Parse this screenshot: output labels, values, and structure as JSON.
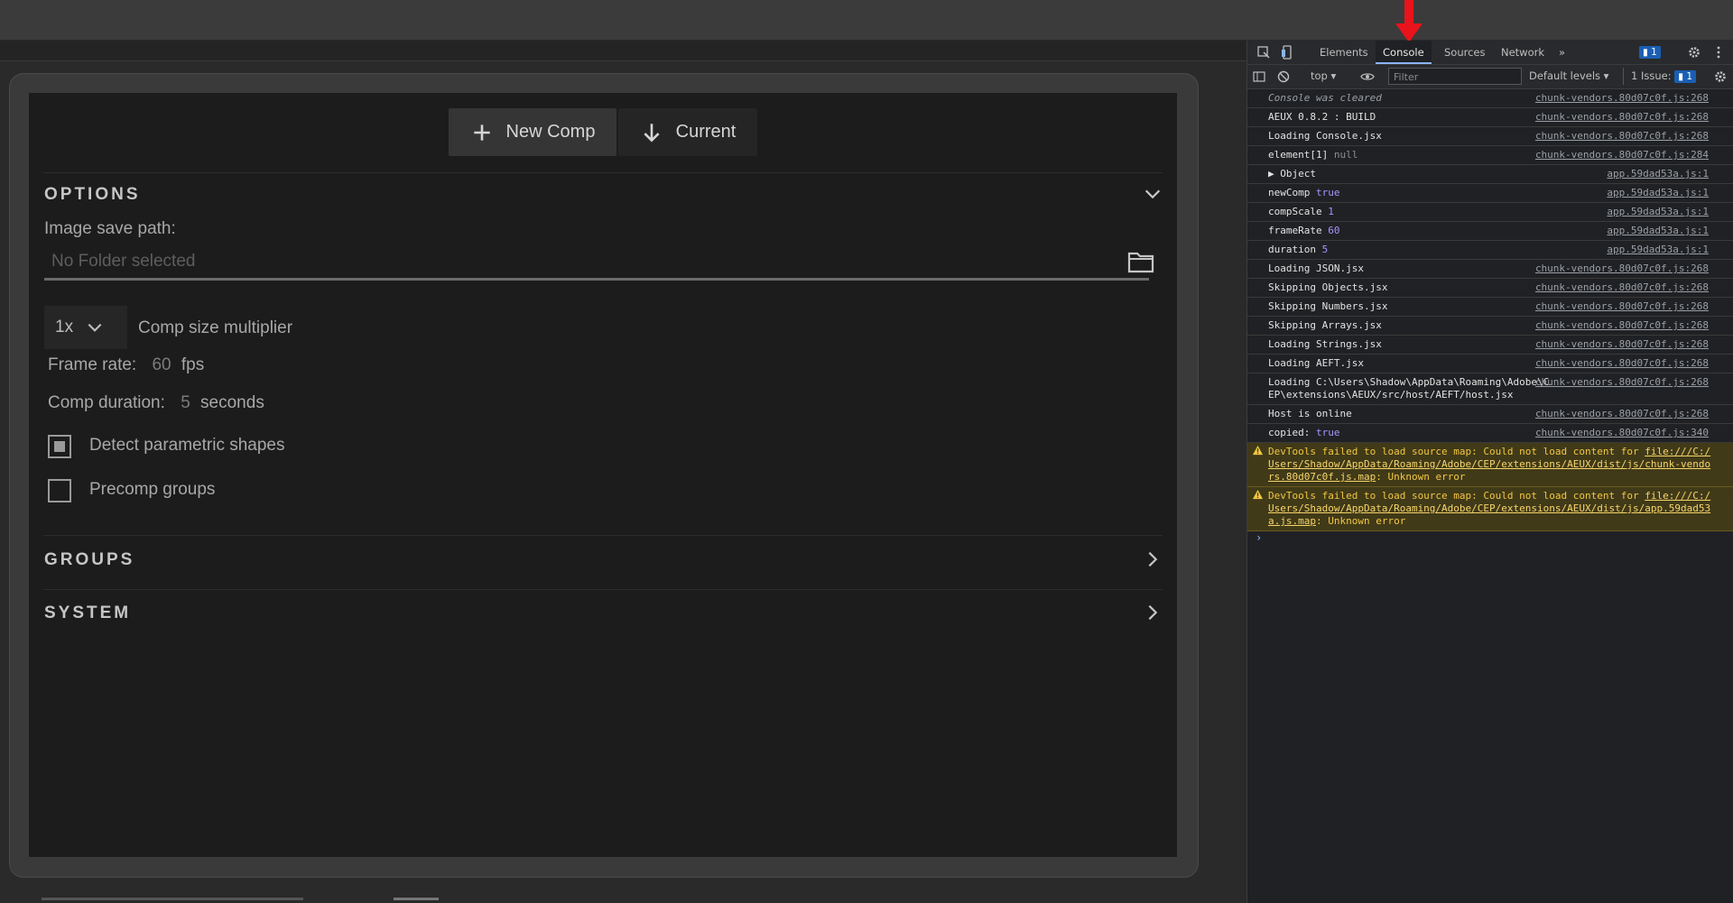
{
  "panel": {
    "buttons": {
      "new_comp": "New Comp",
      "current": "Current"
    },
    "options": {
      "title": "OPTIONS",
      "image_save_path_label": "Image save path:",
      "image_save_path_placeholder": "No Folder selected",
      "multiplier_value": "1x",
      "multiplier_label": "Comp size multiplier",
      "frame_rate_label": "Frame rate:",
      "frame_rate_value": "60",
      "frame_rate_unit": "fps",
      "duration_label": "Comp duration:",
      "duration_value": "5",
      "duration_unit": "seconds",
      "detect_shapes_label": "Detect parametric shapes",
      "detect_shapes_checked": true,
      "precomp_label": "Precomp groups",
      "precomp_checked": false
    },
    "groups_title": "GROUPS",
    "system_title": "SYSTEM"
  },
  "devtools": {
    "tabs": [
      "Elements",
      "Console",
      "Sources",
      "Network"
    ],
    "active_tab": "Console",
    "more_tabs": "»",
    "issues_badge": "1",
    "context": "top",
    "filter_placeholder": "Filter",
    "levels": "Default levels",
    "issues_label": "1 Issue:",
    "issues_count": "1",
    "console_rows": [
      {
        "msg": "Console was cleared",
        "src": "chunk-vendors.80d07c0f.js:268",
        "kind": "cleared"
      },
      {
        "msg": "AEUX 0.8.2 : BUILD",
        "src": "chunk-vendors.80d07c0f.js:268"
      },
      {
        "msg": "Loading Console.jsx",
        "src": "chunk-vendors.80d07c0f.js:268"
      },
      {
        "msg": "element[1]",
        "val": "null",
        "valtype": "null",
        "src": "chunk-vendors.80d07c0f.js:284"
      },
      {
        "msg": "▶ Object",
        "src": "app.59dad53a.js:1"
      },
      {
        "msg": "newComp",
        "val": "true",
        "valtype": "bool",
        "src": "app.59dad53a.js:1"
      },
      {
        "msg": "compScale",
        "val": "1",
        "valtype": "num",
        "src": "app.59dad53a.js:1"
      },
      {
        "msg": "frameRate",
        "val": "60",
        "valtype": "num",
        "src": "app.59dad53a.js:1"
      },
      {
        "msg": "duration",
        "val": "5",
        "valtype": "num",
        "src": "app.59dad53a.js:1"
      },
      {
        "msg": "Loading JSON.jsx",
        "src": "chunk-vendors.80d07c0f.js:268"
      },
      {
        "msg": "Skipping Objects.jsx",
        "src": "chunk-vendors.80d07c0f.js:268"
      },
      {
        "msg": "Skipping Numbers.jsx",
        "src": "chunk-vendors.80d07c0f.js:268"
      },
      {
        "msg": "Skipping Arrays.jsx",
        "src": "chunk-vendors.80d07c0f.js:268"
      },
      {
        "msg": "Loading Strings.jsx",
        "src": "chunk-vendors.80d07c0f.js:268"
      },
      {
        "msg": "Loading AEFT.jsx",
        "src": "chunk-vendors.80d07c0f.js:268"
      },
      {
        "msg": "Loading C:\\Users\\Shadow\\AppData\\Roaming\\Adobe\\CEP\\extensions\\AEUX/src/host/AEFT/host.jsx",
        "src": "chunk-vendors.80d07c0f.js:268"
      },
      {
        "msg": "Host is online",
        "src": "chunk-vendors.80d07c0f.js:268"
      },
      {
        "msg": "copied:",
        "val": "true",
        "valtype": "bool",
        "src": "chunk-vendors.80d07c0f.js:340"
      }
    ],
    "warnings": [
      {
        "pre": "DevTools failed to load source map: Could not load content for ",
        "link": "file:///C:/Users/Shadow/AppData/Roaming/Adobe/CEP/extensions/AEUX/dist/js/chunk-vendors.80d07c0f.js.map",
        "post": ": Unknown error"
      },
      {
        "pre": "DevTools failed to load source map: Could not load content for ",
        "link": "file:///C:/Users/Shadow/AppData/Roaming/Adobe/CEP/extensions/AEUX/dist/js/app.59dad53a.js.map",
        "post": ": Unknown error"
      }
    ],
    "prompt": "›"
  },
  "colors": {
    "arrow": "#e8131b",
    "warn_bg": "#413a18",
    "active_tab_underline": "#8ab4f8"
  }
}
